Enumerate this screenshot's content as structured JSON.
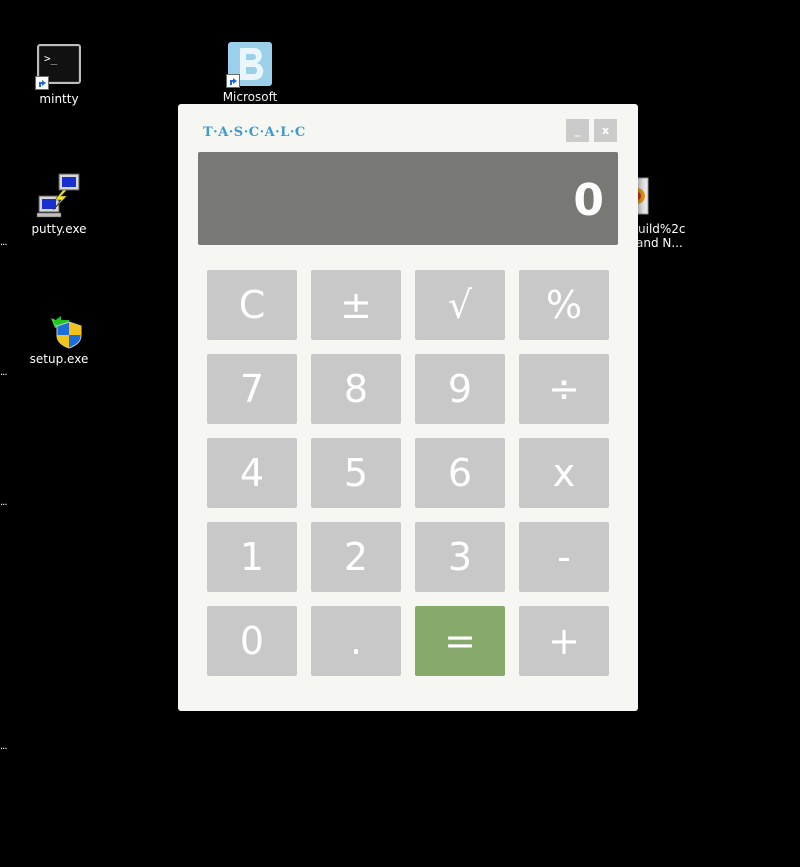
{
  "desktop": {
    "icons": [
      {
        "name": "mintty",
        "label": "mintty"
      },
      {
        "name": "microsoft",
        "label": "Microsoft"
      },
      {
        "name": "putty",
        "label": "putty.exe"
      },
      {
        "name": "setup",
        "label": "setup.exe"
      },
      {
        "name": "build",
        "label_line1": "uild%2c",
        "label_line2": "and N..."
      }
    ],
    "edge_ellipsis": "..."
  },
  "calculator": {
    "title": "T·A·S·C·A·L·C",
    "minimize_label": "_",
    "close_label": "x",
    "display_value": "0",
    "keys": [
      {
        "label": "C",
        "name": "clear-key"
      },
      {
        "label": "±",
        "name": "plus-minus-key"
      },
      {
        "label": "√",
        "name": "square-root-key"
      },
      {
        "label": "%",
        "name": "percent-key"
      },
      {
        "label": "7",
        "name": "digit-7-key"
      },
      {
        "label": "8",
        "name": "digit-8-key"
      },
      {
        "label": "9",
        "name": "digit-9-key"
      },
      {
        "label": "÷",
        "name": "divide-key"
      },
      {
        "label": "4",
        "name": "digit-4-key"
      },
      {
        "label": "5",
        "name": "digit-5-key"
      },
      {
        "label": "6",
        "name": "digit-6-key"
      },
      {
        "label": "x",
        "name": "multiply-key"
      },
      {
        "label": "1",
        "name": "digit-1-key"
      },
      {
        "label": "2",
        "name": "digit-2-key"
      },
      {
        "label": "3",
        "name": "digit-3-key"
      },
      {
        "label": "-",
        "name": "minus-key"
      },
      {
        "label": "0",
        "name": "digit-0-key"
      },
      {
        "label": ".",
        "name": "decimal-point-key"
      },
      {
        "label": "=",
        "name": "equals-key"
      },
      {
        "label": "+",
        "name": "plus-key"
      }
    ],
    "colors": {
      "title": "#3c9acd",
      "window_bg": "#f6f7f3",
      "display_bg": "#787975",
      "key_bg": "#c8c8c8",
      "equals_bg": "#87a96b"
    }
  }
}
